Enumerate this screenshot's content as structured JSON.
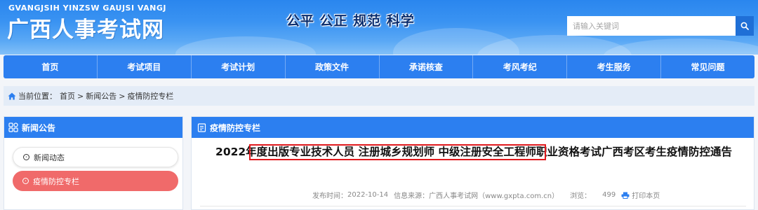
{
  "header": {
    "pinyin": "GVANGJSIH YINZSW GAUJSI VANGJ",
    "site_title": "广西人事考试网",
    "slogan": "公平  公正  规范  科学",
    "search": {
      "placeholder": "请输入关键词"
    }
  },
  "nav": {
    "items": [
      "首页",
      "考试项目",
      "考试计划",
      "政策文件",
      "承诺核查",
      "考风考纪",
      "考生服务",
      "常见问题"
    ]
  },
  "breadcrumb": {
    "label": "当前位置：",
    "items": [
      "首页",
      "新闻公告",
      "疫情防控专栏"
    ],
    "separator": ">"
  },
  "sidebar": {
    "title": "新闻公告",
    "items": [
      {
        "label": "新闻动态",
        "active": false
      },
      {
        "label": "疫情防控专栏",
        "active": true
      }
    ]
  },
  "main": {
    "section_title": "疫情防控专栏",
    "article_title": "2022年度出版专业技术人员 注册城乡规划师 中级注册安全工程师职业资格考试广西考区考生疫情防控通告",
    "meta": {
      "publish_label": "发布时间：",
      "publish_time": "2022-10-14",
      "source_label": "信息来源：",
      "source": "广西人事考试网（www.gxpta.com.cn）",
      "views_label": "浏览：",
      "views": "499",
      "print_label": "打印本页"
    }
  },
  "colors": {
    "primary": "#2c7ff0",
    "active_item": "#f06a6a",
    "highlight_border": "#e0191d",
    "breadcrumb_bg": "#e4ecf7"
  }
}
